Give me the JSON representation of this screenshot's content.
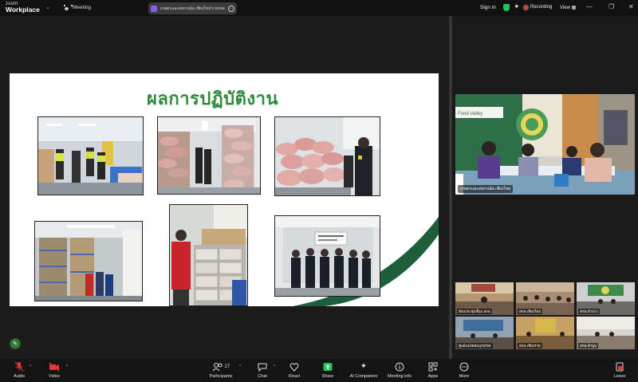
{
  "app": {
    "logo_top": "zoom",
    "logo_bottom": "Workplace",
    "meeting_label": "Meeting",
    "share_title": "เกษตรและสหกรณ์จ.เชียงใหม่'s screen",
    "sign_in": "Sign in",
    "recording": "Recording",
    "view": "View",
    "accent_color": "#2e8b3e",
    "record_color": "#e53935"
  },
  "slide": {
    "title": "ผลการปฏิบัติงาน"
  },
  "speaker": {
    "name": "เกษตรและสหกรณ์จ.เชียงใหม่",
    "banner": "Food Valley"
  },
  "gallery": [
    "ห้องประชุมชั้น2 สกษ",
    "สกษ.เชียงใหม่",
    "สกษ.ลำปาง",
    "ศูนย์แม่งัดสมบูรณ์ชล",
    "สกษ.เชียงราย",
    "สกษ.ลำพูน"
  ],
  "toolbar": {
    "audio": "Audio",
    "video": "Video",
    "participants": "Participants",
    "participants_count": "27",
    "chat": "Chat",
    "react": "React",
    "share": "Share",
    "ai_companion": "AI Companion",
    "meeting_info": "Meeting info",
    "apps": "Apps",
    "more": "More",
    "leave": "Leave"
  }
}
